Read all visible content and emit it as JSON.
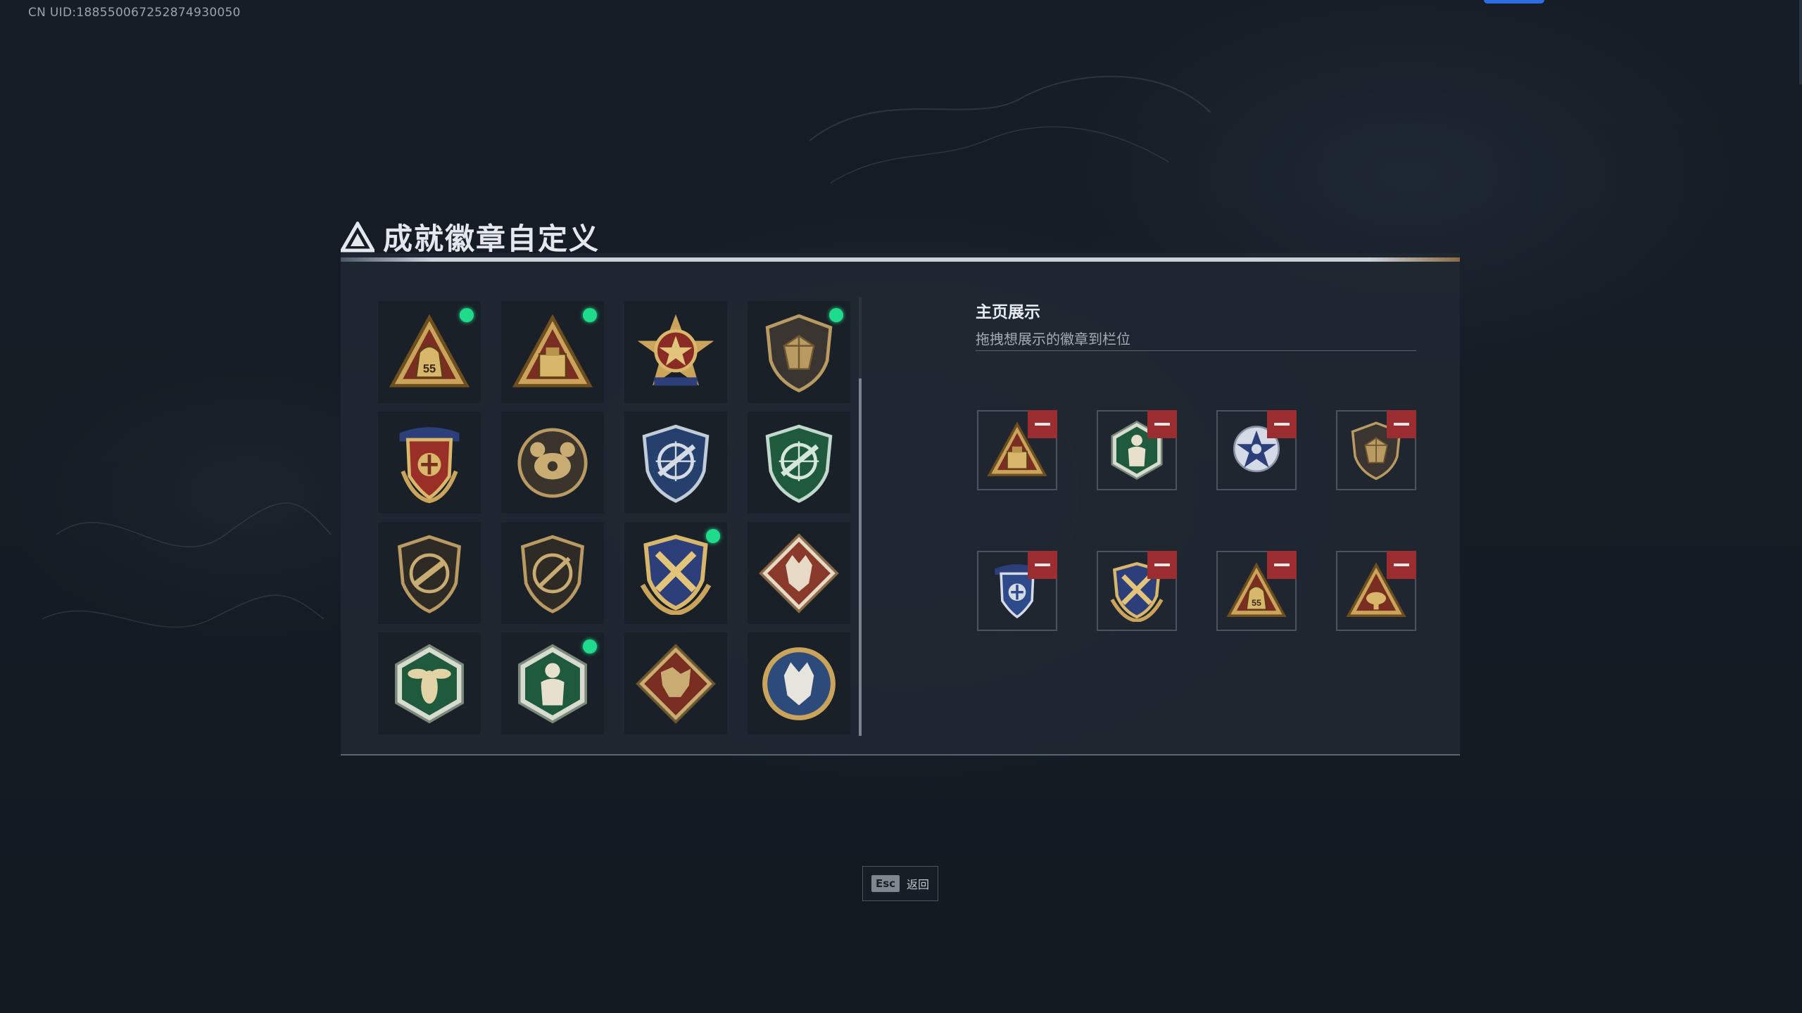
{
  "uid": "CN UID:188550067252874930050",
  "title": "成就徽章自定义",
  "showcase": {
    "heading": "主页展示",
    "hint": "拖拽想展示的徽章到栏位"
  },
  "badges": [
    {
      "icon": "tri-bag-55-badge",
      "new": true
    },
    {
      "icon": "tri-crate-badge",
      "new": true
    },
    {
      "icon": "skull-star-badge",
      "new": false
    },
    {
      "icon": "gem-shield-badge",
      "new": true
    },
    {
      "icon": "eagle-laurel-badge",
      "new": false
    },
    {
      "icon": "crab-badge",
      "new": false
    },
    {
      "icon": "blue-rifle-shield-badge",
      "new": false
    },
    {
      "icon": "green-rifle-shield-badge",
      "new": false
    },
    {
      "icon": "pistol-shield-badge",
      "new": false
    },
    {
      "icon": "shotgun-shield-badge",
      "new": false
    },
    {
      "icon": "gold-cross-weapon-badge",
      "new": true
    },
    {
      "icon": "red-wolf-diamond-badge",
      "new": false
    },
    {
      "icon": "green-hornet-badge",
      "new": false
    },
    {
      "icon": "green-soldier-badge",
      "new": true
    },
    {
      "icon": "red-dragon-diamond-badge",
      "new": false
    },
    {
      "icon": "blue-wolf-circle-badge",
      "new": false
    }
  ],
  "slots": [
    {
      "icon": "tri-crate-badge"
    },
    {
      "icon": "green-soldier-badge"
    },
    {
      "icon": "blue-star-badge"
    },
    {
      "icon": "gem-shield-badge"
    },
    {
      "icon": "blue-laurel-badge"
    },
    {
      "icon": "gold-cross-weapon-badge"
    },
    {
      "icon": "tri-bag-55-badge"
    },
    {
      "icon": "tri-tank-badge"
    }
  ],
  "esc": {
    "key": "Esc",
    "label": "返回"
  },
  "colors": {
    "new_dot": "#1fdc8c",
    "remove": "#9b2c2f",
    "accent": "#2d6ee6"
  }
}
